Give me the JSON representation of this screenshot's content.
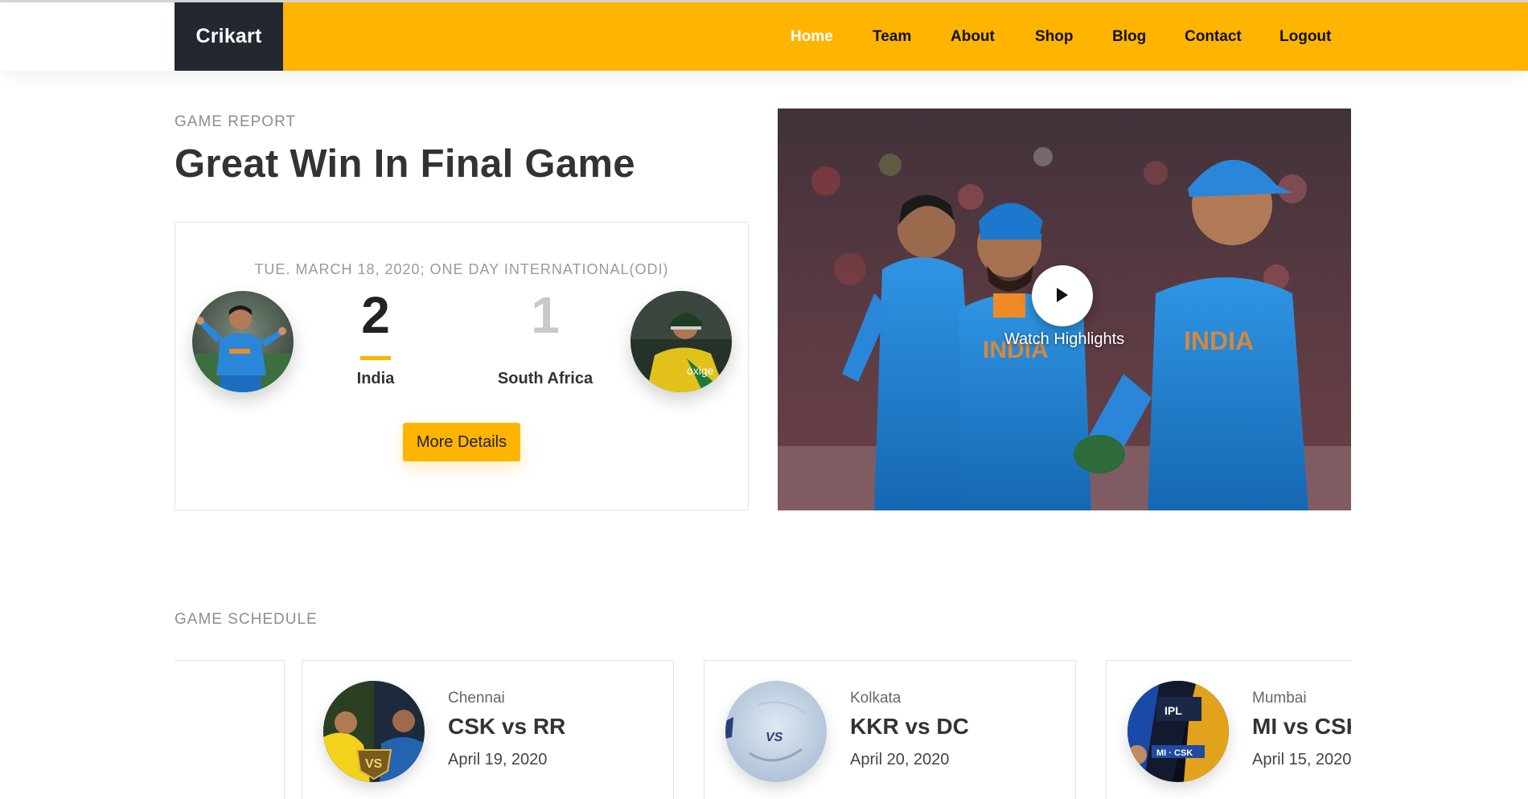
{
  "brand": {
    "logo": "Crikart"
  },
  "nav": {
    "items": [
      {
        "label": "Home",
        "active": true
      },
      {
        "label": "Team",
        "active": false
      },
      {
        "label": "About",
        "active": false
      },
      {
        "label": "Shop",
        "active": false
      },
      {
        "label": "Blog",
        "active": false
      },
      {
        "label": "Contact",
        "active": false
      },
      {
        "label": "Logout",
        "active": false
      }
    ]
  },
  "report": {
    "eyebrow": "GAME REPORT",
    "title": "Great Win In Final Game",
    "match_info": "TUE. MARCH 18, 2020; ONE DAY INTERNATIONAL(ODI)",
    "home": {
      "name": "India",
      "score": "2"
    },
    "away": {
      "name": "South Africa",
      "score": "1"
    },
    "details_button": "More Details",
    "video_label": "Watch Highlights"
  },
  "schedule": {
    "eyebrow": "GAME SCHEDULE",
    "matches": [
      {
        "city": "Chennai",
        "match": "CSK vs RR",
        "date": "April 19, 2020"
      },
      {
        "city": "Kolkata",
        "match": "KKR vs DC",
        "date": "April 20, 2020"
      },
      {
        "city": "Mumbai",
        "match": "MI vs CSK",
        "date": "April 15, 2020"
      }
    ]
  },
  "colors": {
    "accent": "#ffb400",
    "dark": "#232830",
    "team_blue": "#1e88d6"
  },
  "icons": {
    "play": "play-icon"
  }
}
